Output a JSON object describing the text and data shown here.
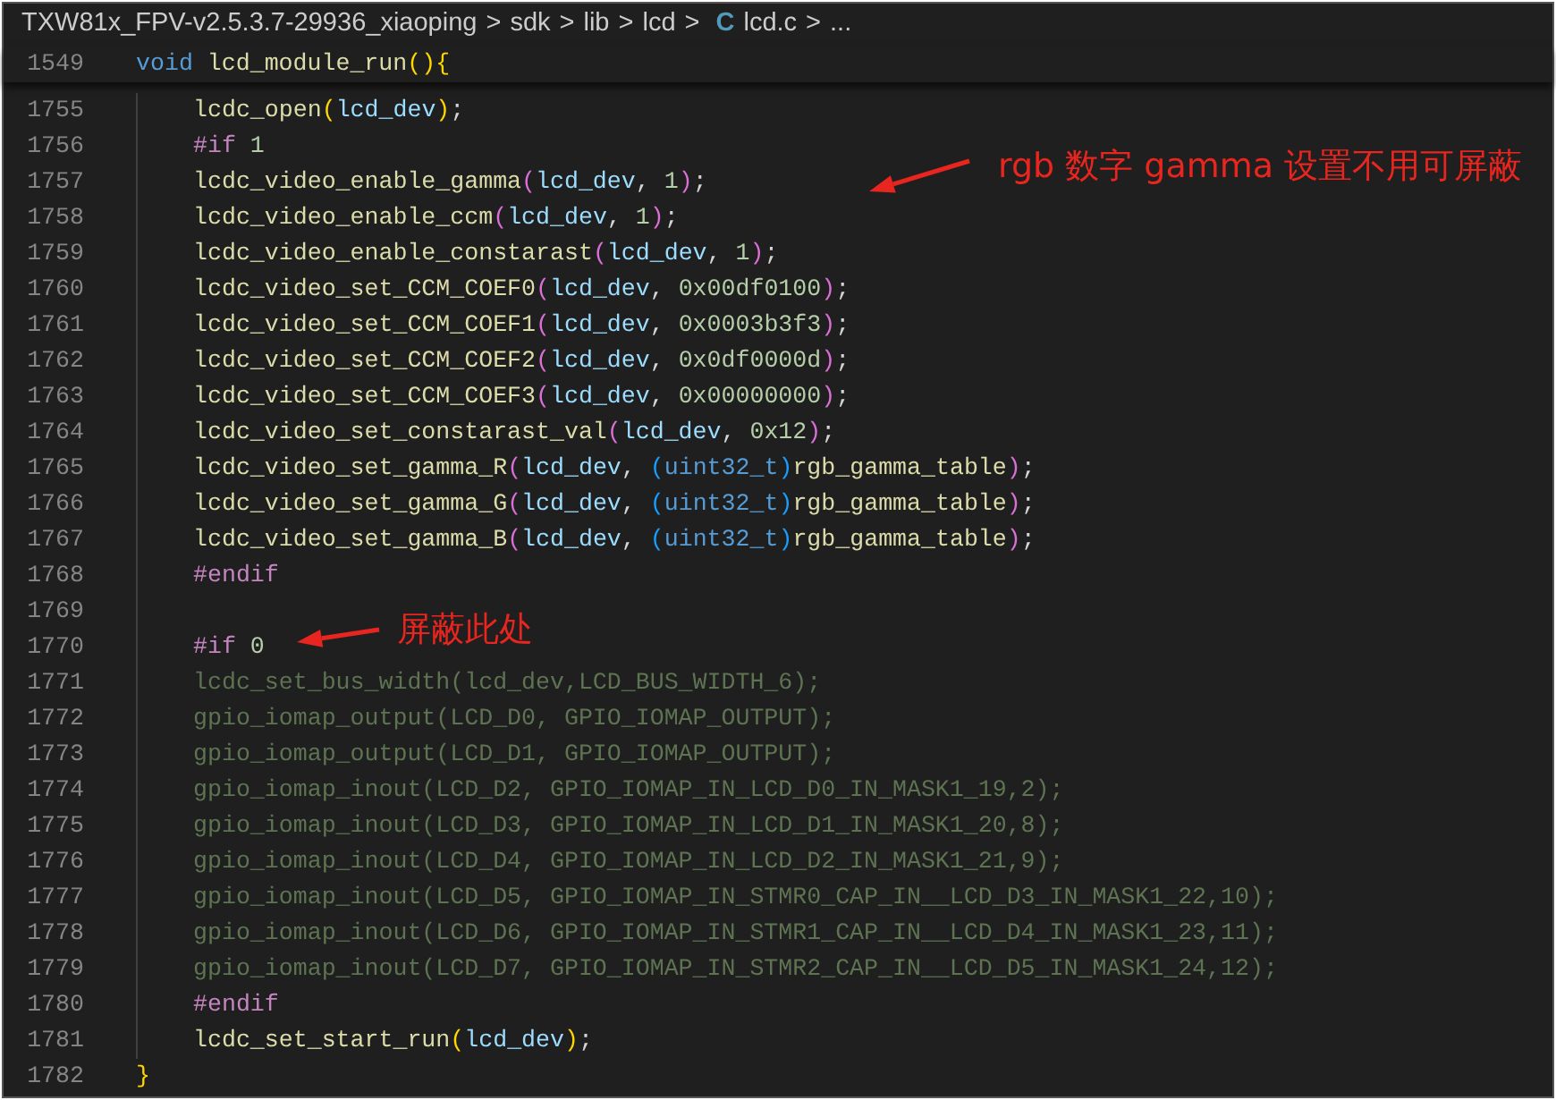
{
  "breadcrumbs": [
    {
      "kind": "folder",
      "text": "TXW81x_FPV-v2.5.3.7-29936_xiaoping"
    },
    {
      "kind": "sep",
      "text": ">"
    },
    {
      "kind": "folder",
      "text": "sdk"
    },
    {
      "kind": "sep",
      "text": ">"
    },
    {
      "kind": "folder",
      "text": "lib"
    },
    {
      "kind": "sep",
      "text": ">"
    },
    {
      "kind": "folder",
      "text": "lcd"
    },
    {
      "kind": "sep",
      "text": ">"
    },
    {
      "kind": "lang",
      "text": "C"
    },
    {
      "kind": "file",
      "text": "lcd.c"
    },
    {
      "kind": "sep",
      "text": ">"
    },
    {
      "kind": "more",
      "text": "..."
    }
  ],
  "sticky_line": {
    "number": "1549",
    "indented": false,
    "tokens": [
      {
        "kind": "keyword",
        "text": "void "
      },
      {
        "kind": "fn",
        "text": "lcd_module_run"
      },
      {
        "kind": "p1",
        "text": "()"
      },
      {
        "kind": "p1",
        "text": "{"
      }
    ]
  },
  "lines": [
    {
      "number": "1755",
      "indented": true,
      "tokens": [
        {
          "kind": "fn",
          "text": "lcdc_open"
        },
        {
          "kind": "p1",
          "text": "("
        },
        {
          "kind": "var",
          "text": "lcd_dev"
        },
        {
          "kind": "p1",
          "text": ")"
        },
        {
          "kind": "punc",
          "text": ";"
        }
      ]
    },
    {
      "number": "1756",
      "indented": true,
      "tokens": [
        {
          "kind": "macro",
          "text": "#if "
        },
        {
          "kind": "num",
          "text": "1"
        }
      ]
    },
    {
      "number": "1757",
      "indented": true,
      "tokens": [
        {
          "kind": "fn",
          "text": "lcdc_video_enable_gamma"
        },
        {
          "kind": "p2",
          "text": "("
        },
        {
          "kind": "var",
          "text": "lcd_dev"
        },
        {
          "kind": "punc",
          "text": ", "
        },
        {
          "kind": "num",
          "text": "1"
        },
        {
          "kind": "p2",
          "text": ")"
        },
        {
          "kind": "punc",
          "text": ";"
        }
      ]
    },
    {
      "number": "1758",
      "indented": true,
      "tokens": [
        {
          "kind": "fn",
          "text": "lcdc_video_enable_ccm"
        },
        {
          "kind": "p2",
          "text": "("
        },
        {
          "kind": "var",
          "text": "lcd_dev"
        },
        {
          "kind": "punc",
          "text": ", "
        },
        {
          "kind": "num",
          "text": "1"
        },
        {
          "kind": "p2",
          "text": ")"
        },
        {
          "kind": "punc",
          "text": ";"
        }
      ]
    },
    {
      "number": "1759",
      "indented": true,
      "tokens": [
        {
          "kind": "fn",
          "text": "lcdc_video_enable_constarast"
        },
        {
          "kind": "p2",
          "text": "("
        },
        {
          "kind": "var",
          "text": "lcd_dev"
        },
        {
          "kind": "punc",
          "text": ", "
        },
        {
          "kind": "num",
          "text": "1"
        },
        {
          "kind": "p2",
          "text": ")"
        },
        {
          "kind": "punc",
          "text": ";"
        }
      ]
    },
    {
      "number": "1760",
      "indented": true,
      "tokens": [
        {
          "kind": "fn",
          "text": "lcdc_video_set_CCM_COEF0"
        },
        {
          "kind": "p2",
          "text": "("
        },
        {
          "kind": "var",
          "text": "lcd_dev"
        },
        {
          "kind": "punc",
          "text": ", "
        },
        {
          "kind": "num",
          "text": "0x00df0100"
        },
        {
          "kind": "p2",
          "text": ")"
        },
        {
          "kind": "punc",
          "text": ";"
        }
      ]
    },
    {
      "number": "1761",
      "indented": true,
      "tokens": [
        {
          "kind": "fn",
          "text": "lcdc_video_set_CCM_COEF1"
        },
        {
          "kind": "p2",
          "text": "("
        },
        {
          "kind": "var",
          "text": "lcd_dev"
        },
        {
          "kind": "punc",
          "text": ", "
        },
        {
          "kind": "num",
          "text": "0x0003b3f3"
        },
        {
          "kind": "p2",
          "text": ")"
        },
        {
          "kind": "punc",
          "text": ";"
        }
      ]
    },
    {
      "number": "1762",
      "indented": true,
      "tokens": [
        {
          "kind": "fn",
          "text": "lcdc_video_set_CCM_COEF2"
        },
        {
          "kind": "p2",
          "text": "("
        },
        {
          "kind": "var",
          "text": "lcd_dev"
        },
        {
          "kind": "punc",
          "text": ", "
        },
        {
          "kind": "num",
          "text": "0x0df0000d"
        },
        {
          "kind": "p2",
          "text": ")"
        },
        {
          "kind": "punc",
          "text": ";"
        }
      ]
    },
    {
      "number": "1763",
      "indented": true,
      "tokens": [
        {
          "kind": "fn",
          "text": "lcdc_video_set_CCM_COEF3"
        },
        {
          "kind": "p2",
          "text": "("
        },
        {
          "kind": "var",
          "text": "lcd_dev"
        },
        {
          "kind": "punc",
          "text": ", "
        },
        {
          "kind": "num",
          "text": "0x00000000"
        },
        {
          "kind": "p2",
          "text": ")"
        },
        {
          "kind": "punc",
          "text": ";"
        }
      ]
    },
    {
      "number": "1764",
      "indented": true,
      "tokens": [
        {
          "kind": "fn",
          "text": "lcdc_video_set_constarast_val"
        },
        {
          "kind": "p2",
          "text": "("
        },
        {
          "kind": "var",
          "text": "lcd_dev"
        },
        {
          "kind": "punc",
          "text": ", "
        },
        {
          "kind": "num",
          "text": "0x12"
        },
        {
          "kind": "p2",
          "text": ")"
        },
        {
          "kind": "punc",
          "text": ";"
        }
      ]
    },
    {
      "number": "1765",
      "indented": true,
      "tokens": [
        {
          "kind": "fn",
          "text": "lcdc_video_set_gamma_R"
        },
        {
          "kind": "p2",
          "text": "("
        },
        {
          "kind": "var",
          "text": "lcd_dev"
        },
        {
          "kind": "punc",
          "text": ", "
        },
        {
          "kind": "p3",
          "text": "("
        },
        {
          "kind": "type",
          "text": "uint32_t"
        },
        {
          "kind": "p3",
          "text": ")"
        },
        {
          "kind": "fn",
          "text": "rgb_gamma_table"
        },
        {
          "kind": "p2",
          "text": ")"
        },
        {
          "kind": "punc",
          "text": ";"
        }
      ]
    },
    {
      "number": "1766",
      "indented": true,
      "tokens": [
        {
          "kind": "fn",
          "text": "lcdc_video_set_gamma_G"
        },
        {
          "kind": "p2",
          "text": "("
        },
        {
          "kind": "var",
          "text": "lcd_dev"
        },
        {
          "kind": "punc",
          "text": ", "
        },
        {
          "kind": "p3",
          "text": "("
        },
        {
          "kind": "type",
          "text": "uint32_t"
        },
        {
          "kind": "p3",
          "text": ")"
        },
        {
          "kind": "fn",
          "text": "rgb_gamma_table"
        },
        {
          "kind": "p2",
          "text": ")"
        },
        {
          "kind": "punc",
          "text": ";"
        }
      ]
    },
    {
      "number": "1767",
      "indented": true,
      "tokens": [
        {
          "kind": "fn",
          "text": "lcdc_video_set_gamma_B"
        },
        {
          "kind": "p2",
          "text": "("
        },
        {
          "kind": "var",
          "text": "lcd_dev"
        },
        {
          "kind": "punc",
          "text": ", "
        },
        {
          "kind": "p3",
          "text": "("
        },
        {
          "kind": "type",
          "text": "uint32_t"
        },
        {
          "kind": "p3",
          "text": ")"
        },
        {
          "kind": "fn",
          "text": "rgb_gamma_table"
        },
        {
          "kind": "p2",
          "text": ")"
        },
        {
          "kind": "punc",
          "text": ";"
        }
      ]
    },
    {
      "number": "1768",
      "indented": true,
      "tokens": [
        {
          "kind": "macro",
          "text": "#endif"
        }
      ]
    },
    {
      "number": "1769",
      "indented": true
    },
    {
      "number": "1770",
      "indented": true,
      "tokens": [
        {
          "kind": "macro",
          "text": "#if "
        },
        {
          "kind": "num",
          "text": "0"
        }
      ]
    },
    {
      "number": "1771",
      "indented": true,
      "tokens": [
        {
          "kind": "inactive",
          "text": "lcdc_set_bus_width(lcd_dev,LCD_BUS_WIDTH_6);"
        }
      ]
    },
    {
      "number": "1772",
      "indented": true,
      "tokens": [
        {
          "kind": "inactive",
          "text": "gpio_iomap_output(LCD_D0, GPIO_IOMAP_OUTPUT);"
        }
      ]
    },
    {
      "number": "1773",
      "indented": true,
      "tokens": [
        {
          "kind": "inactive",
          "text": "gpio_iomap_output(LCD_D1, GPIO_IOMAP_OUTPUT);"
        }
      ]
    },
    {
      "number": "1774",
      "indented": true,
      "tokens": [
        {
          "kind": "inactive",
          "text": "gpio_iomap_inout(LCD_D2, GPIO_IOMAP_IN_LCD_D0_IN_MASK1_19,2);"
        }
      ]
    },
    {
      "number": "1775",
      "indented": true,
      "tokens": [
        {
          "kind": "inactive",
          "text": "gpio_iomap_inout(LCD_D3, GPIO_IOMAP_IN_LCD_D1_IN_MASK1_20,8);"
        }
      ]
    },
    {
      "number": "1776",
      "indented": true,
      "tokens": [
        {
          "kind": "inactive",
          "text": "gpio_iomap_inout(LCD_D4, GPIO_IOMAP_IN_LCD_D2_IN_MASK1_21,9);"
        }
      ]
    },
    {
      "number": "1777",
      "indented": true,
      "tokens": [
        {
          "kind": "inactive",
          "text": "gpio_iomap_inout(LCD_D5, GPIO_IOMAP_IN_STMR0_CAP_IN__LCD_D3_IN_MASK1_22,10);"
        }
      ]
    },
    {
      "number": "1778",
      "indented": true,
      "tokens": [
        {
          "kind": "inactive",
          "text": "gpio_iomap_inout(LCD_D6, GPIO_IOMAP_IN_STMR1_CAP_IN__LCD_D4_IN_MASK1_23,11);"
        }
      ]
    },
    {
      "number": "1779",
      "indented": true,
      "tokens": [
        {
          "kind": "inactive",
          "text": "gpio_iomap_inout(LCD_D7, GPIO_IOMAP_IN_STMR2_CAP_IN__LCD_D5_IN_MASK1_24,12);"
        }
      ]
    },
    {
      "number": "1780",
      "indented": true,
      "tokens": [
        {
          "kind": "macro",
          "text": "#endif"
        }
      ]
    },
    {
      "number": "1781",
      "indented": true,
      "tokens": [
        {
          "kind": "fn",
          "text": "lcdc_set_start_run"
        },
        {
          "kind": "p1",
          "text": "("
        },
        {
          "kind": "var",
          "text": "lcd_dev"
        },
        {
          "kind": "p1",
          "text": ")"
        },
        {
          "kind": "punc",
          "text": ";"
        }
      ]
    },
    {
      "number": "1782",
      "indented": false,
      "tokens": [
        {
          "kind": "p1",
          "text": "}"
        }
      ]
    }
  ],
  "annotations": [
    {
      "text": "rgb 数字 gamma 设置不用可屏蔽"
    },
    {
      "text": "屏蔽此处"
    }
  ]
}
